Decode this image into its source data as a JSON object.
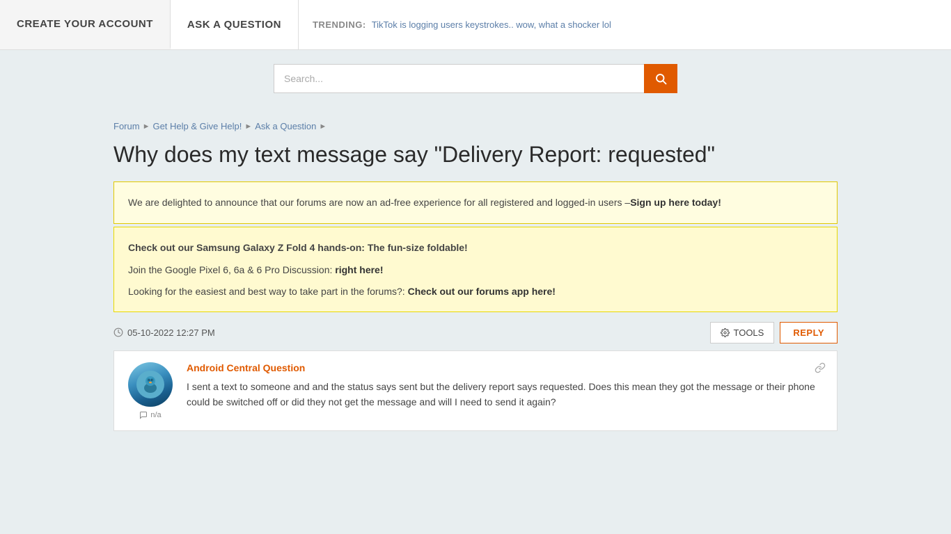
{
  "nav": {
    "create_account_label": "CREATE YOUR ACCOUNT",
    "ask_question_label": "ASK A QUESTION",
    "trending_label": "TRENDING:",
    "trending_text": "TikTok is logging users keystrokes.. wow, what a shocker lol"
  },
  "search": {
    "placeholder": "Search...",
    "button_icon": "🔍"
  },
  "breadcrumb": {
    "items": [
      {
        "label": "Forum"
      },
      {
        "label": "Get Help & Give Help!"
      },
      {
        "label": "Ask a Question"
      }
    ]
  },
  "page": {
    "title": "Why does my text message say \"Delivery Report: requested\""
  },
  "notices": {
    "ad_free": {
      "text_before": "We are delighted to announce that our forums are now an ad-free experience for all registered and logged-in users –",
      "link_text": "Sign up here today!",
      "text_after": ""
    },
    "samsung": {
      "headline": "Check out our Samsung Galaxy Z Fold 4 hands-on: The fun-size foldable!",
      "pixel_before": "Join the Google Pixel 6, 6a & 6 Pro Discussion: ",
      "pixel_link": "right here!",
      "app_before": "Looking for the easiest and best way to take part in the forums?: ",
      "app_link": "Check out our forums app here!"
    }
  },
  "post_meta": {
    "date": "05-10-2022 12:27 PM",
    "tools_label": "TOOLS",
    "reply_label": "REPLY"
  },
  "post": {
    "author": "Android Central Question",
    "avatar_emoji": "🐦",
    "comment_count": "n/a",
    "text": "I sent a text to someone and and the status says sent but the delivery report says requested. Does this mean they got the message or their phone could be switched off or did they not get the message and will I need to send it again?",
    "link_icon": "🔗"
  }
}
